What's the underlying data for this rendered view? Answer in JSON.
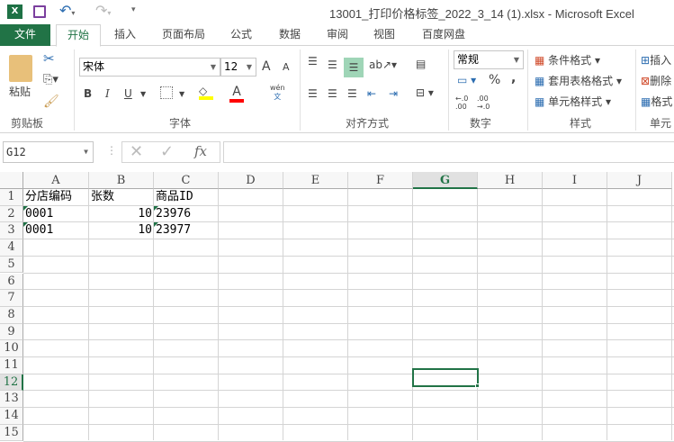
{
  "window": {
    "title": "13001_打印价格标签_2022_3_14 (1).xlsx - Microsoft Excel"
  },
  "tabs": [
    "文件",
    "开始",
    "插入",
    "页面布局",
    "公式",
    "数据",
    "审阅",
    "视图",
    "百度网盘"
  ],
  "ribbon": {
    "clipboard": {
      "paste": "粘贴",
      "label": "剪贴板"
    },
    "font": {
      "name": "宋体",
      "size": "12",
      "label": "字体",
      "bold": "B",
      "italic": "I",
      "underline": "U",
      "phonetic_top": "wén",
      "phonetic_bottom": "文",
      "grow": "A",
      "shrink": "A",
      "font_color": "A"
    },
    "alignment": {
      "label": "对齐方式"
    },
    "number": {
      "format": "常规",
      "percent": "%",
      "comma": ",",
      "inc_decimal": "←.0 .00",
      "dec_decimal": ".00 →.0",
      "label": "数字"
    },
    "styles": {
      "conditional": "条件格式",
      "table": "套用表格格式",
      "cell": "单元格样式",
      "label": "样式"
    },
    "cells": {
      "insert": "插入",
      "delete": "删除",
      "format": "格式",
      "label": "单元"
    }
  },
  "formula_bar": {
    "name_box": "G12",
    "fx": "fx",
    "value": ""
  },
  "columns": [
    "A",
    "B",
    "C",
    "D",
    "E",
    "F",
    "G",
    "H",
    "I",
    "J"
  ],
  "rows": [
    "1",
    "2",
    "3",
    "4",
    "5",
    "6",
    "7",
    "8",
    "9",
    "10",
    "11",
    "12",
    "13",
    "14",
    "15"
  ],
  "cells": [
    [
      "分店编码",
      "张数",
      "商品ID"
    ],
    [
      "0001",
      "10",
      "23976"
    ],
    [
      "0001",
      "10",
      "23977"
    ]
  ],
  "colors": {
    "accent": "#217346",
    "selected": "#1e7145"
  }
}
